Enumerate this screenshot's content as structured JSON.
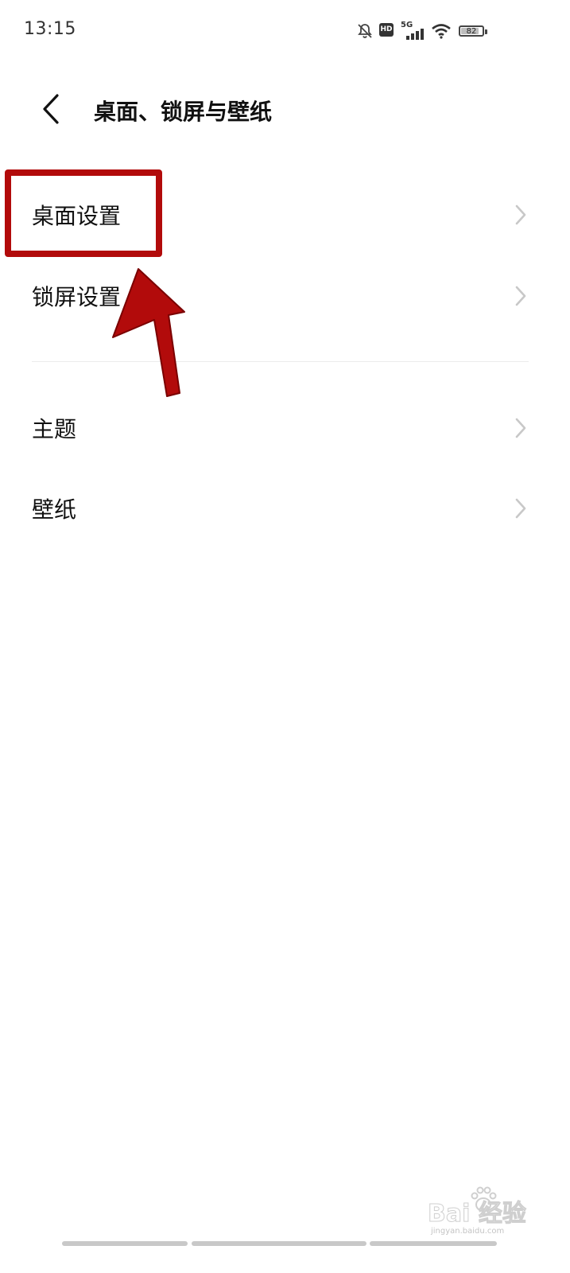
{
  "status_bar": {
    "time": "13:15",
    "hd_label": "HD",
    "network_label": "5G",
    "battery_level": "82",
    "icons": [
      "bell-off-icon",
      "hd-icon",
      "5g-signal-icon",
      "wifi-icon",
      "battery-icon"
    ]
  },
  "header": {
    "title": "桌面、锁屏与壁纸",
    "back_icon": "chevron-left-icon"
  },
  "settings": {
    "group1": [
      {
        "label": "桌面设置",
        "icon": "chevron-right-icon"
      },
      {
        "label": "锁屏设置",
        "icon": "chevron-right-icon"
      }
    ],
    "group2": [
      {
        "label": "主题",
        "icon": "chevron-right-icon"
      },
      {
        "label": "壁纸",
        "icon": "chevron-right-icon"
      }
    ]
  },
  "annotation": {
    "highlight_color": "#b20b0b",
    "arrow_color": "#b20b0b"
  },
  "watermark": {
    "main": "Bai 经验",
    "sub": "jingyan.baidu.com"
  },
  "colors": {
    "background": "#ffffff",
    "text": "#111111",
    "chevron": "#c8c8c8",
    "divider": "#ececec"
  }
}
